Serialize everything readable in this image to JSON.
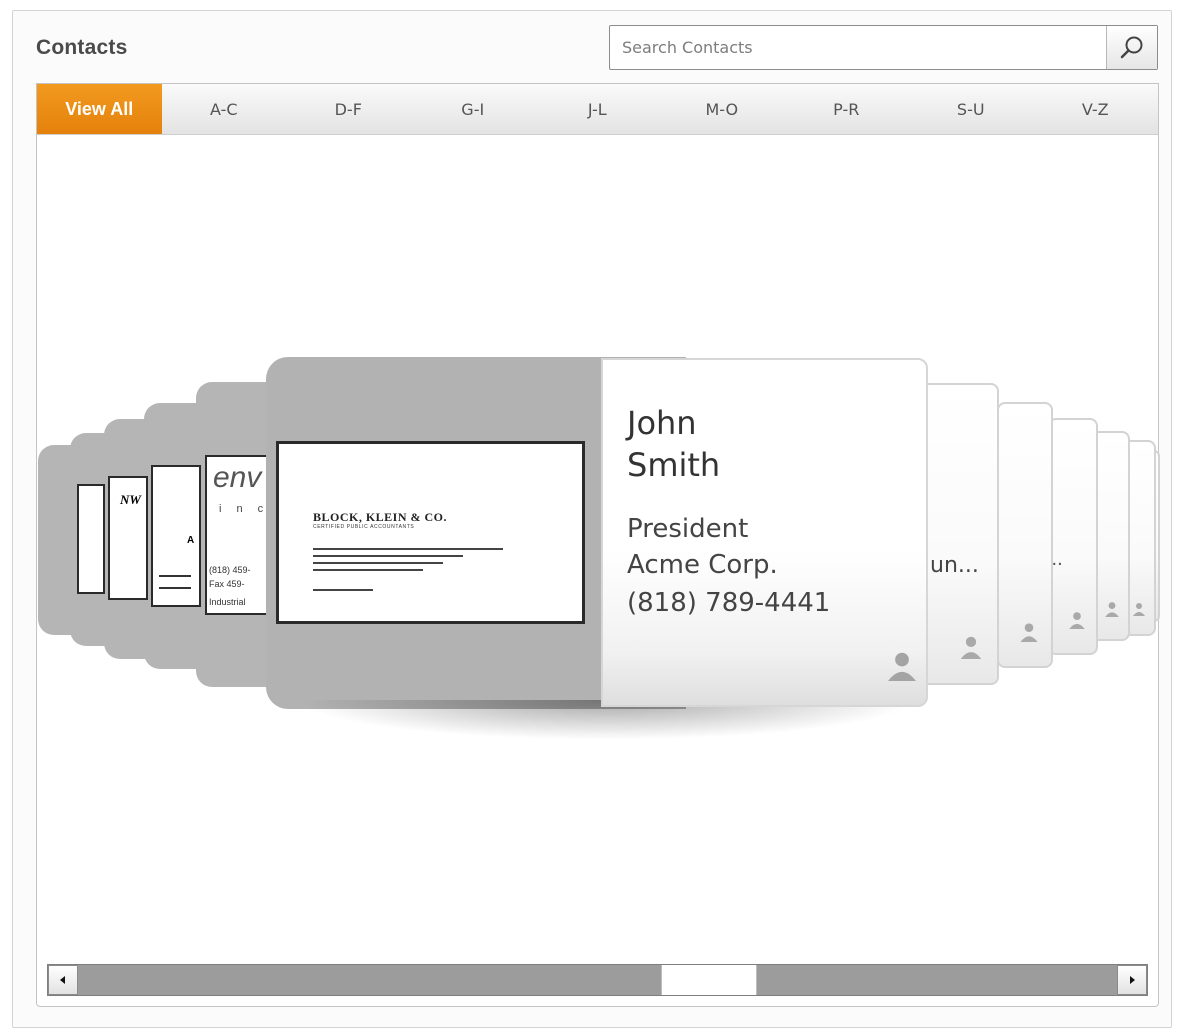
{
  "header": {
    "title": "Contacts"
  },
  "search": {
    "placeholder": "Search Contacts"
  },
  "tabs": [
    "View All",
    "A-C",
    "D-F",
    "G-I",
    "J-L",
    "M-O",
    "P-R",
    "S-U",
    "V-Z"
  ],
  "active_tab": "View All",
  "featured_contact": {
    "first_name": "John",
    "last_name": "Smith",
    "title": "President",
    "company": "Acme Corp.",
    "phone": "(818) 789-4441",
    "card_image": {
      "line1": "BLOCK, KLEIN & CO.",
      "line2": "CERTIFIED PUBLIC ACCOUNTANTS"
    }
  },
  "side_card_snippets": [
    "un...",
    "..."
  ],
  "thumb_snippets": {
    "env_logo": "env",
    "env_sub": "i n c",
    "phone_frag": "(818) 459-",
    "fax_frag": "Fax 459-",
    "ind_frag": "Industrial",
    "nw": "NW",
    "a_letter": "A"
  },
  "colors": {
    "accent": "#e98a15",
    "card_bg": "#b2b2b2"
  },
  "icons": {
    "search": "magnifier-icon",
    "contact": "person-icon",
    "left": "arrow-left-icon",
    "right": "arrow-right-icon"
  }
}
